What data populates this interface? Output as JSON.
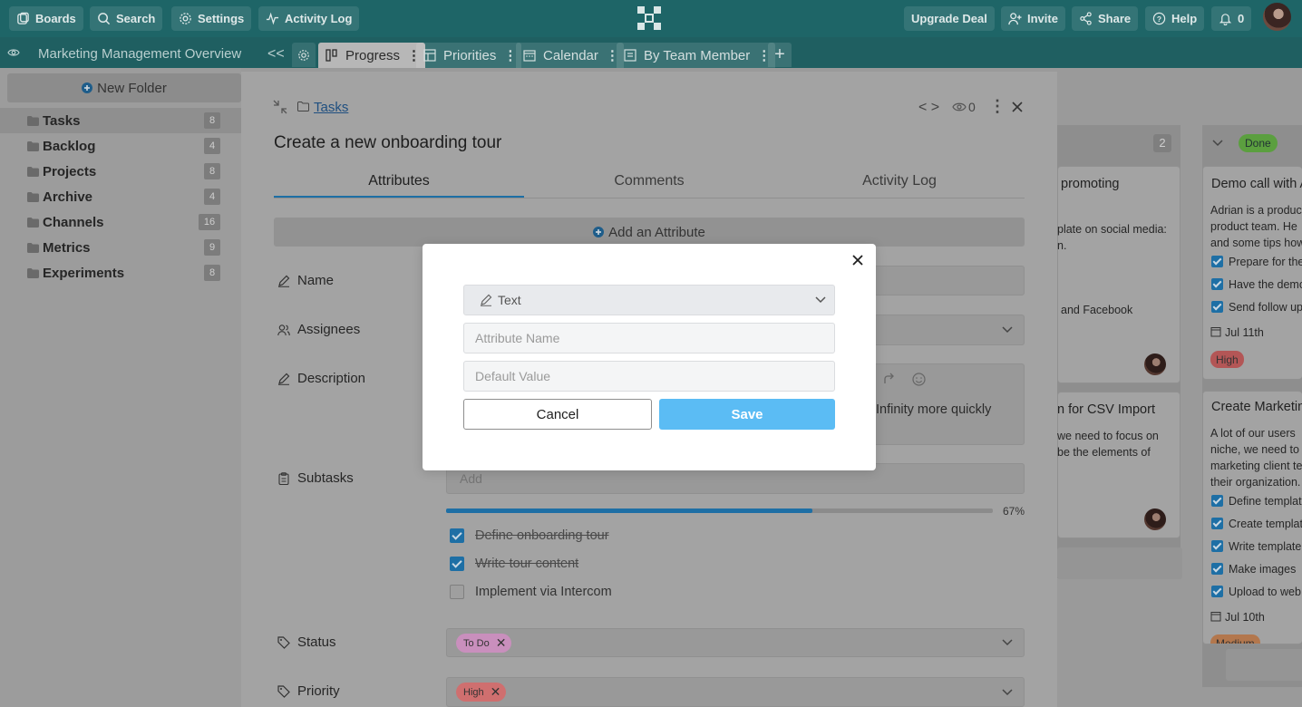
{
  "topbar": {
    "boards": "Boards",
    "search": "Search",
    "settings": "Settings",
    "activity_log": "Activity Log",
    "upgrade": "Upgrade Deal",
    "invite": "Invite",
    "share": "Share",
    "help": "Help",
    "notifications_count": "0"
  },
  "tabbar": {
    "board_name": "Marketing Management Overview",
    "collapse": "<<",
    "tabs": [
      {
        "label": "Progress",
        "active": true
      },
      {
        "label": "Priorities",
        "active": false
      },
      {
        "label": "Calendar",
        "active": false
      },
      {
        "label": "By Team Member",
        "active": false
      }
    ]
  },
  "sidebar": {
    "new_folder": "New Folder",
    "folders": [
      {
        "name": "Tasks",
        "count": "8"
      },
      {
        "name": "Backlog",
        "count": "4"
      },
      {
        "name": "Projects",
        "count": "8"
      },
      {
        "name": "Archive",
        "count": "4"
      },
      {
        "name": "Channels",
        "count": "16"
      },
      {
        "name": "Metrics",
        "count": "9"
      },
      {
        "name": "Experiments",
        "count": "8"
      }
    ]
  },
  "board": {
    "col_count": "2",
    "done_label": "Done",
    "card1_title": "promoting",
    "card1_line1": "plate on social media:",
    "card1_line2": "n.",
    "card1_line3": "and Facebook",
    "card2_title": "n for CSV Import",
    "card2_line1": "we need to focus on",
    "card2_line2": "be the elements of",
    "demo_title": "Demo call with A",
    "demo_lines": [
      "Adrian is a produc",
      "product team. He",
      "and some tips how"
    ],
    "demo_checks": [
      "Prepare for the",
      "Have the demo",
      "Send follow up"
    ],
    "demo_date": "Jul 11th",
    "demo_priority": "High",
    "mkt_title": "Create Marketin",
    "mkt_lines": [
      "A lot of our users",
      "niche, we need to",
      "marketing client te",
      "their organization."
    ],
    "mkt_checks": [
      "Define templat",
      "Create templat",
      "Write template",
      "Make images",
      "Upload to web"
    ],
    "mkt_date": "Jul 10th",
    "mkt_priority": "Medium"
  },
  "task": {
    "breadcrumb": "Tasks",
    "watchers": "0",
    "title": "Create a new onboarding tour",
    "tabs": [
      "Attributes",
      "Comments",
      "Activity Log"
    ],
    "add_attribute": "Add an Attribute",
    "fields": {
      "name": "Name",
      "assignees": "Assignees",
      "description": "Description",
      "description_text": "Infinity more quickly",
      "subtasks": "Subtasks",
      "subtask_placeholder": "Add",
      "status": "Status",
      "priority": "Priority"
    },
    "progress": {
      "percent_label": "67%",
      "fraction": 0.67
    },
    "subtasks": [
      {
        "label": "Define onboarding tour",
        "done": true
      },
      {
        "label": "Write tour content",
        "done": true
      },
      {
        "label": "Implement via Intercom",
        "done": false
      }
    ],
    "status_tag": "To Do",
    "priority_tag": "High"
  },
  "dialog": {
    "type_label": "Text",
    "attribute_name_placeholder": "Attribute Name",
    "default_value_placeholder": "Default Value",
    "cancel": "Cancel",
    "save": "Save"
  },
  "colors": {
    "topbar": "#1e6567",
    "accent": "#1e6fa5",
    "save_button": "#5bbcf4",
    "tag_todo": "#c98fbd",
    "tag_high": "#cf6f6f"
  }
}
